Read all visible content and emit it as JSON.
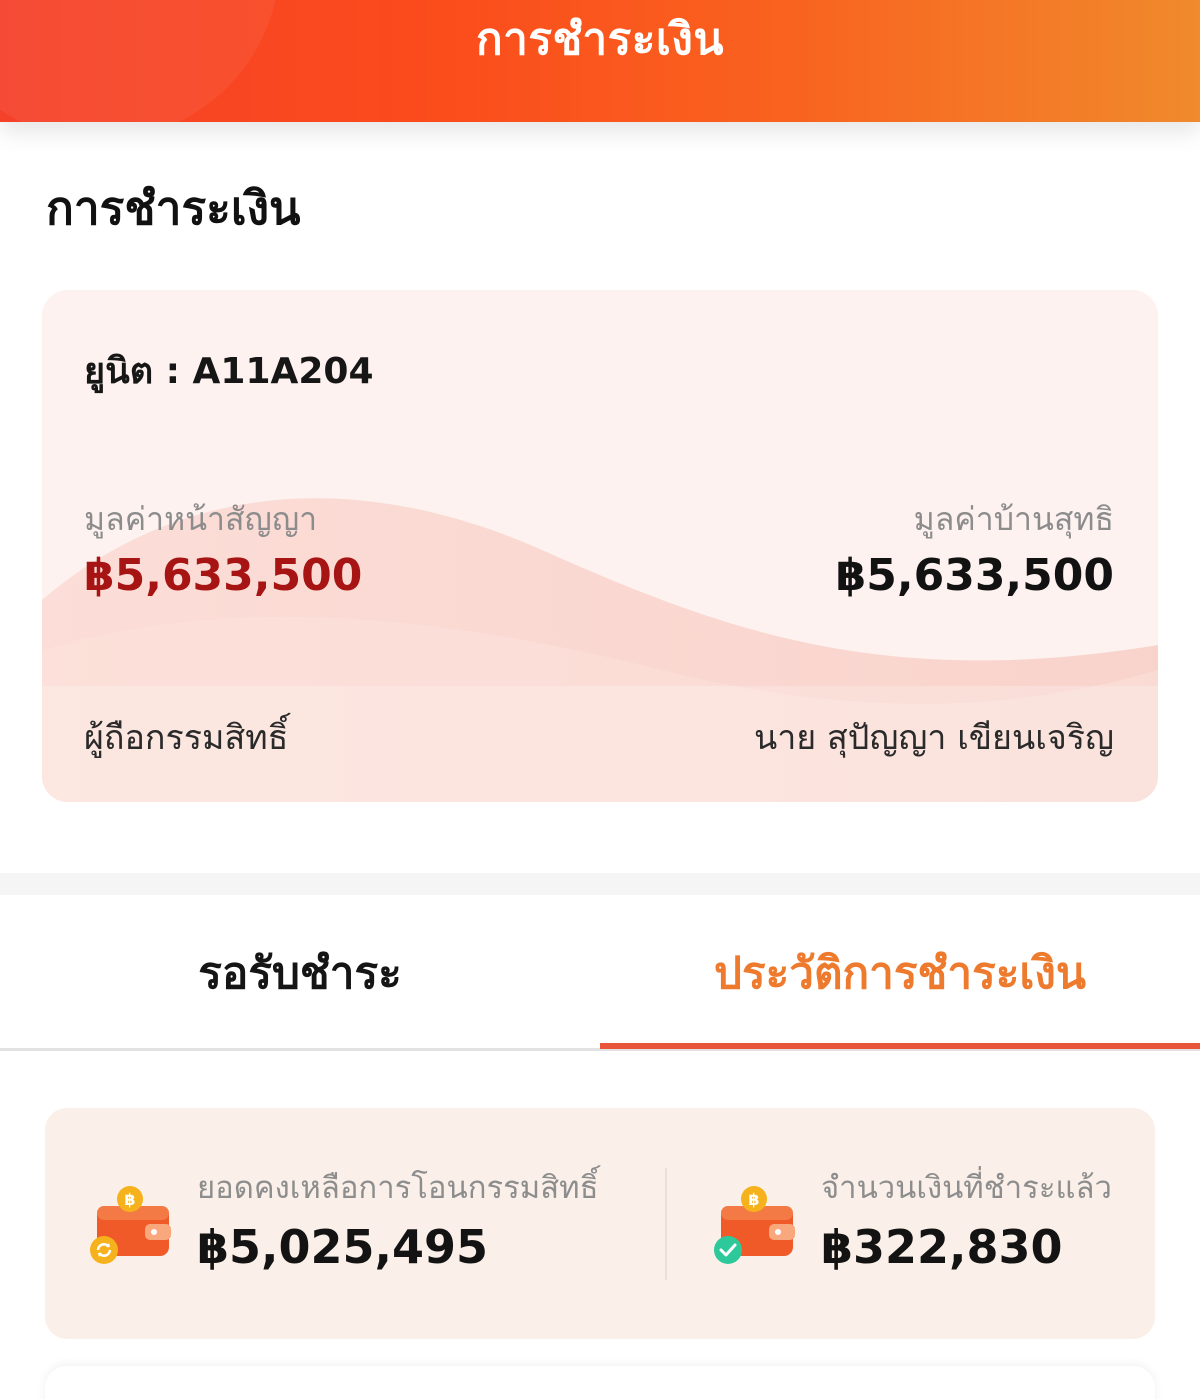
{
  "header": {
    "title": "การชำระเงิน"
  },
  "page": {
    "title": "การชำระเงิน"
  },
  "unit_card": {
    "unit_text": "ยูนิต : A11A204",
    "contract_value_label": "มูลค่าหน้าสัญญา",
    "contract_value": "฿5,633,500",
    "net_value_label": "มูลค่าบ้านสุทธิ",
    "net_value": "฿5,633,500",
    "owner_label": "ผู้ถือกรรมสิทธิ์",
    "owner_name": "นาย สุปัญญา เขียนเจริญ"
  },
  "tabs": [
    {
      "label": "รอรับชำระ",
      "active": false
    },
    {
      "label": "ประวัติการชำระเงิน",
      "active": true
    }
  ],
  "summary": {
    "remaining_label": "ยอดคงเหลือการโอนกรรมสิทธิ์",
    "remaining_amount": "฿5,025,495",
    "remaining_icon": "wallet-refresh-icon",
    "paid_label": "จำนวนเงินที่ชำระแล้ว",
    "paid_amount": "฿322,830",
    "paid_icon": "wallet-check-icon"
  },
  "colors": {
    "header_start": "#f5402a",
    "header_end": "#f08a2c",
    "accent": "#ee7a2e",
    "tab_indicator": "#e8553a",
    "contract_value": "#a61414"
  }
}
